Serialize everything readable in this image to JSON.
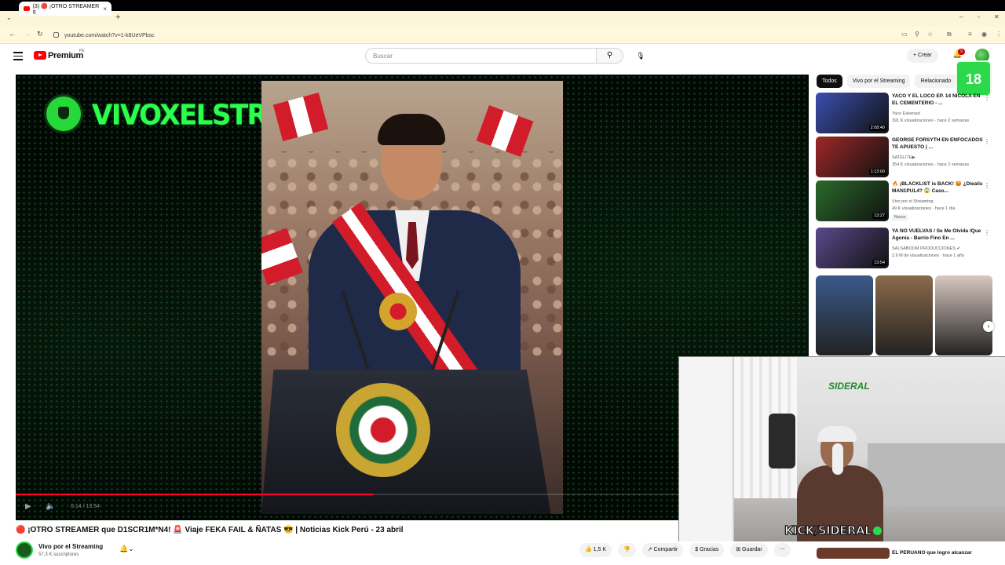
{
  "browser": {
    "tab_title": "(3) 🔴 ¡OTRO STREAMER q",
    "tab_close": "×",
    "new_tab": "+",
    "url": "youtube.com/watch?v=1-k8UeVPbsc",
    "win_min": "–",
    "win_max": "▫",
    "win_close": "✕"
  },
  "header": {
    "brand": "Premium",
    "region": "PE",
    "search_placeholder": "Buscar",
    "create_label": "+ Crear",
    "notif_count": "9"
  },
  "player": {
    "overlay_title": "VIVOXELSTREAMING",
    "time": "6:14 / 13:54",
    "progress_fraction": 0.45
  },
  "video": {
    "title": "🔴 ¡OTRO STREAMER que D1SCR1M*N4! 🚨 Viaje FEKA FAIL & ÑATAS 😎 | Noticias Kick Perú - 23 abril",
    "channel": "Vivo por el Streaming",
    "subscribers": "57,3 K suscriptores",
    "actions": {
      "likes": "👍 1,5 K",
      "dislike": "👎",
      "share": "↗ Compartir",
      "thanks": "$ Gracias",
      "save": "⊞ Guardar",
      "more": "⋯"
    }
  },
  "sidebar": {
    "age_badge": "18",
    "chips": [
      "Todos",
      "Vivo por el Streaming",
      "Relacionado"
    ],
    "recs": [
      {
        "title": "YACO Y EL LOCO EP. 14 NICOLA EN EL CEMENTERIO - ...",
        "channel": "Yaco Eskenazi",
        "meta": "391 K visualizaciones · hace 2 semanas",
        "duration": "2:08:40",
        "badge": "",
        "thumb_color": "#3b4fb0"
      },
      {
        "title": "GEORGE FORSYTH EN ENFOCADOS TE APUESTO | ...",
        "channel": "SATÉLITE▶",
        "meta": "354 K visualizaciones · hace 2 semanas",
        "duration": "1:13:00",
        "badge": "",
        "thumb_color": "#a02828"
      },
      {
        "title": "🔥 ¡BLACKLIST is BACK! 😡 ¿Diealis MAN1PUL4? 😱 Caso...",
        "channel": "Vivo por el Streaming",
        "meta": "49 K visualizaciones · hace 1 día",
        "duration": "13:27",
        "badge": "Nuevo",
        "thumb_color": "#2a6a2a"
      },
      {
        "title": "YA NO VUELVAS / Se Me Olvida /Que Agonía - Barrio Fino En ...",
        "channel": "SALSABOOM PRODUCCIONES ✔",
        "meta": "2,6 M de visualizaciones · hace 1 año",
        "duration": "13:54",
        "badge": "",
        "thumb_color": "#5a4a8a"
      }
    ],
    "shorts_colors": [
      "#3a5a8a",
      "#8a6a4a",
      "#d8c8c0"
    ],
    "bottom_title": "EL PERUANO que logro alcanzar"
  },
  "webcam": {
    "brand": "KICK/SIDERAL",
    "wall_logo": "SIDERAL"
  },
  "colors": {
    "yt_red": "#ff0000",
    "neon_green": "#2cff4a"
  }
}
